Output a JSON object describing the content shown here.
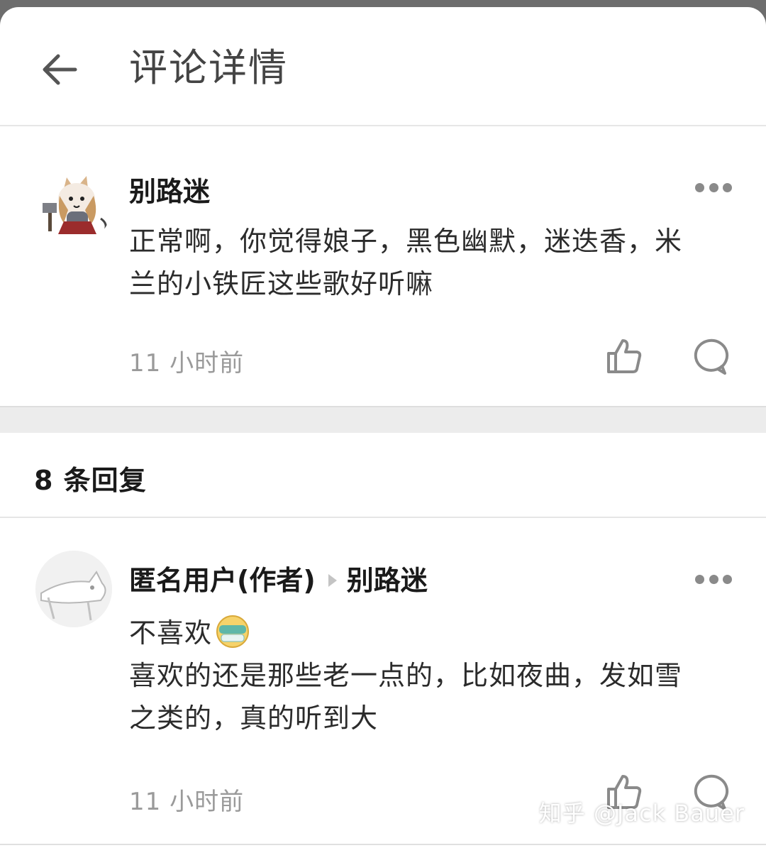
{
  "header": {
    "title": "评论详情"
  },
  "root_comment": {
    "author": "别路迷",
    "text_line1": "正常啊，你觉得娘子，黑色幽默，迷迭香，米",
    "text_line2": "兰的小铁匠这些歌好听嘛",
    "time": "11 小时前"
  },
  "replies": {
    "count_label": "8 条回复",
    "items": [
      {
        "author": "匿名用户(作者)",
        "reply_to": "别路迷",
        "text_line1": "不喜欢",
        "emoji": "masked-face-emoji",
        "text_line2": "喜欢的还是那些老一点的，比如夜曲，发如雪",
        "text_line3": "之类的，真的听到大",
        "time": "11 小时前"
      }
    ]
  },
  "watermark": "知乎 @Jack Bauer",
  "icons": {
    "back": "arrow-left-icon",
    "more": "more-dots-icon",
    "like": "thumbs-up-icon",
    "reply": "comment-bubble-icon"
  },
  "colors": {
    "title": "#444444",
    "author": "#1a1a1a",
    "meta": "#9a9a9a",
    "icon": "#8a8a8a",
    "band": "#ececec"
  }
}
